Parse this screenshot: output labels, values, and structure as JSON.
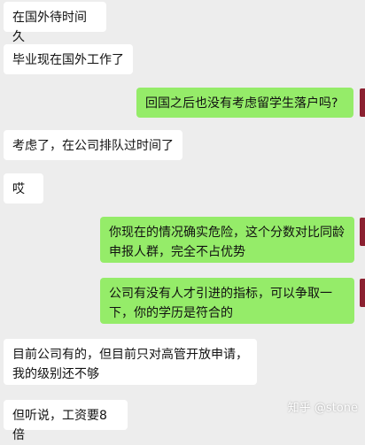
{
  "chat": {
    "messages": [
      {
        "side": "incoming",
        "text": "在国外待时间久"
      },
      {
        "side": "incoming",
        "text": "毕业现在国外工作了"
      },
      {
        "side": "outgoing",
        "text": "回国之后也没有考虑留学生落户吗?"
      },
      {
        "side": "incoming",
        "text": "考虑了，在公司排队过时间了"
      },
      {
        "side": "incoming",
        "text": "哎"
      },
      {
        "side": "outgoing",
        "text": "你现在的情况确实危险，这个分数对比同龄申报人群，完全不占优势"
      },
      {
        "side": "outgoing",
        "text": "公司有没有人才引进的指标，可以争取一下，你的学历是符合的"
      },
      {
        "side": "incoming",
        "text": "目前公司有的，但目前只对高管开放申请，我的级别还不够"
      },
      {
        "side": "incoming",
        "text": "但听说，工资要8倍"
      }
    ]
  },
  "watermark": {
    "text": "知乎 @stone"
  },
  "colors": {
    "background": "#ededed",
    "incoming": "#ffffff",
    "outgoing": "#95ec69",
    "avatar": "#8b2030"
  }
}
